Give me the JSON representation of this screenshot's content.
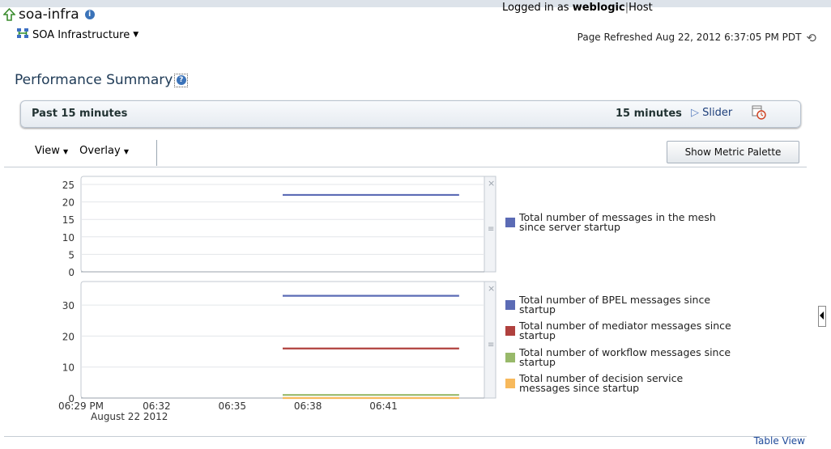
{
  "header": {
    "title": "soa-infra",
    "target_menu": "SOA Infrastructure",
    "logged_in_prefix": "Logged in as",
    "user": "weblogic",
    "host_label": "Host",
    "refresh_text": "Page Refreshed Aug 22, 2012 6:37:05 PM PDT"
  },
  "section": {
    "title": "Performance Summary"
  },
  "timebar": {
    "range_label": "Past 15 minutes",
    "duration": "15 minutes",
    "slider_label": "Slider"
  },
  "toolbar": {
    "view_label": "View",
    "overlay_label": "Overlay",
    "palette_button": "Show Metric Palette"
  },
  "footer": {
    "table_view": "Table View"
  },
  "colors": {
    "blue": "#5b6bb5",
    "red": "#b0413e",
    "green": "#98b96a",
    "orange": "#f7b95c"
  },
  "chart_data": [
    {
      "type": "line",
      "x_ticks": [
        "06:29 PM",
        "06:32",
        "06:35",
        "06:38",
        "06:41"
      ],
      "ylim": [
        0,
        25
      ],
      "y_ticks": [
        0,
        5,
        10,
        15,
        20,
        25
      ],
      "series": [
        {
          "name": "Total number of messages in the mesh since server startup",
          "color": "#5b6bb5",
          "x": [
            "06:37",
            "06:44"
          ],
          "values": [
            22,
            22
          ]
        }
      ]
    },
    {
      "type": "line",
      "x_ticks": [
        "06:29 PM",
        "06:32",
        "06:35",
        "06:38",
        "06:41"
      ],
      "x_sublabel": "August 22 2012",
      "ylim": [
        0,
        35
      ],
      "y_ticks": [
        0,
        10,
        20,
        30
      ],
      "series": [
        {
          "name": "Total number of BPEL messages since startup",
          "color": "#5b6bb5",
          "x": [
            "06:37",
            "06:44"
          ],
          "values": [
            33,
            33
          ]
        },
        {
          "name": "Total number of mediator messages since startup",
          "color": "#b0413e",
          "x": [
            "06:37",
            "06:44"
          ],
          "values": [
            16,
            16
          ]
        },
        {
          "name": "Total number of workflow messages since startup",
          "color": "#98b96a",
          "x": [
            "06:37",
            "06:44"
          ],
          "values": [
            1,
            1
          ]
        },
        {
          "name": "Total number of decision service messages since startup",
          "color": "#f7b95c",
          "x": [
            "06:37",
            "06:44"
          ],
          "values": [
            0,
            0
          ]
        }
      ]
    }
  ]
}
